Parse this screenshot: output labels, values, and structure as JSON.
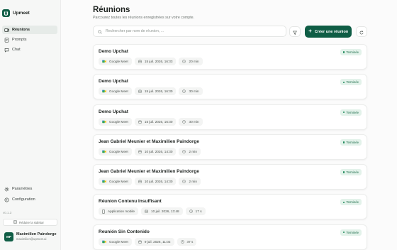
{
  "app": {
    "name": "Upmeet"
  },
  "sidebar": {
    "items": [
      {
        "label": "Réunions",
        "icon": "meetings-icon",
        "active": true
      },
      {
        "label": "Prompts",
        "icon": "prompts-icon",
        "active": false
      },
      {
        "label": "Chat",
        "icon": "chat-icon",
        "active": false
      }
    ],
    "bottom_items": [
      {
        "label": "Paramètres",
        "icon": "settings-icon"
      },
      {
        "label": "Configuration",
        "icon": "configuration-icon"
      }
    ],
    "version": "v0.1.3",
    "collapse_label": "Réduire la sidebar",
    "user": {
      "initials": "MP",
      "name": "Maximilien Paindorge",
      "email": "maximilien@upmeet.ai"
    }
  },
  "header": {
    "title": "Réunions",
    "subtitle": "Parcourez toutes les réunions enregistrées sur votre compte."
  },
  "search": {
    "placeholder": "Rechercher par nom de réunion, ...",
    "value": ""
  },
  "toolbar": {
    "create_label": "Créer une réunion"
  },
  "colors": {
    "brand": "#0f5d45",
    "status_bg": "#e3f2ea",
    "status_text": "#1c6b4a"
  },
  "meetings": [
    {
      "title": "Demo Upchat",
      "source": "Google Meet",
      "source_icon": "google-meet-icon",
      "date": "15 juil. 2026, 16:33",
      "duration": "20 min",
      "status": "Terminée"
    },
    {
      "title": "Demo Upchat",
      "source": "Google Meet",
      "source_icon": "google-meet-icon",
      "date": "15 juil. 2026, 16:30",
      "duration": "30 min",
      "status": "Terminée"
    },
    {
      "title": "Demo Upchat",
      "source": "Google Meet",
      "source_icon": "google-meet-icon",
      "date": "15 juil. 2026, 16:30",
      "duration": "30 min",
      "status": "Terminée"
    },
    {
      "title": "Jean Gabriel Meunier et Maximilien Paindorge",
      "source": "Google Meet",
      "source_icon": "google-meet-icon",
      "date": "10 juil. 2026, 14:30",
      "duration": "2 min",
      "status": "Terminée"
    },
    {
      "title": "Jean Gabriel Meunier et Maximilien Paindorge",
      "source": "Google Meet",
      "source_icon": "google-meet-icon",
      "date": "10 juil. 2026, 14:30",
      "duration": "2 min",
      "status": "Terminée"
    },
    {
      "title": "Réunion Contenu Insuffisant",
      "source": "Application mobile",
      "source_icon": "mobile-icon",
      "date": "10 juil. 2026, 13:48",
      "duration": "17 s",
      "status": "Terminée"
    },
    {
      "title": "Reunión Sin Contenido",
      "source": "Google Meet",
      "source_icon": "google-meet-icon",
      "date": "9 juil. 2026, 11:02",
      "duration": "37 s",
      "status": "Terminée"
    }
  ]
}
